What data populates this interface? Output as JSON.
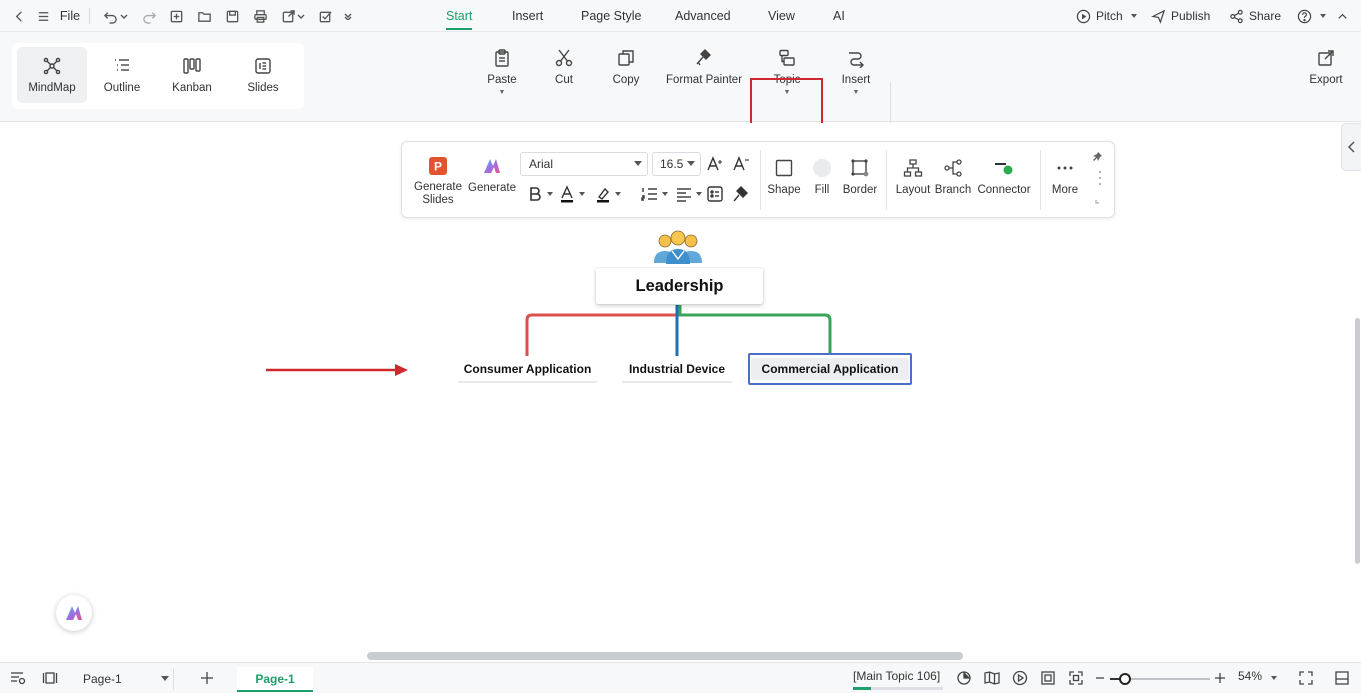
{
  "menubar": {
    "file_label": "File",
    "tabs": [
      {
        "label": "Start",
        "active": true
      },
      {
        "label": "Insert"
      },
      {
        "label": "Page Style"
      },
      {
        "label": "Advanced"
      },
      {
        "label": "View"
      },
      {
        "label": "AI"
      }
    ],
    "right": {
      "pitch": "Pitch",
      "publish": "Publish",
      "share": "Share"
    }
  },
  "views": [
    {
      "label": "MindMap",
      "active": true
    },
    {
      "label": "Outline"
    },
    {
      "label": "Kanban"
    },
    {
      "label": "Slides"
    }
  ],
  "ribbon": {
    "paste": "Paste",
    "cut": "Cut",
    "copy": "Copy",
    "format_painter": "Format Painter",
    "topic": "Topic",
    "insert": "Insert",
    "export": "Export"
  },
  "floatbar": {
    "generate_slides": "Generate Slides",
    "generate": "Generate",
    "font_family": "Arial",
    "font_size": "16.5",
    "shape": "Shape",
    "fill": "Fill",
    "border": "Border",
    "layout": "Layout",
    "branch": "Branch",
    "connector": "Connector",
    "more": "More"
  },
  "mindmap": {
    "central_topic": "Leadership",
    "subtopics": [
      {
        "label": "Consumer Application",
        "branch_color": "#d9514c"
      },
      {
        "label": "Industrial Device",
        "branch_color": "#1f6fb2"
      },
      {
        "label": "Commercial Application",
        "branch_color": "#3aa55a",
        "selected": true
      }
    ],
    "annotation_arrow_color": "#d0282e"
  },
  "statusbar": {
    "page_select": "Page-1",
    "page_tab": "Page-1",
    "selection_info": "[Main Topic 106]",
    "zoom": "54%",
    "zoom_fraction": 0.15
  },
  "colors": {
    "accent": "#1e9e6a",
    "highlight_box": "#d0282e",
    "selection_border": "#4a6fc9"
  }
}
